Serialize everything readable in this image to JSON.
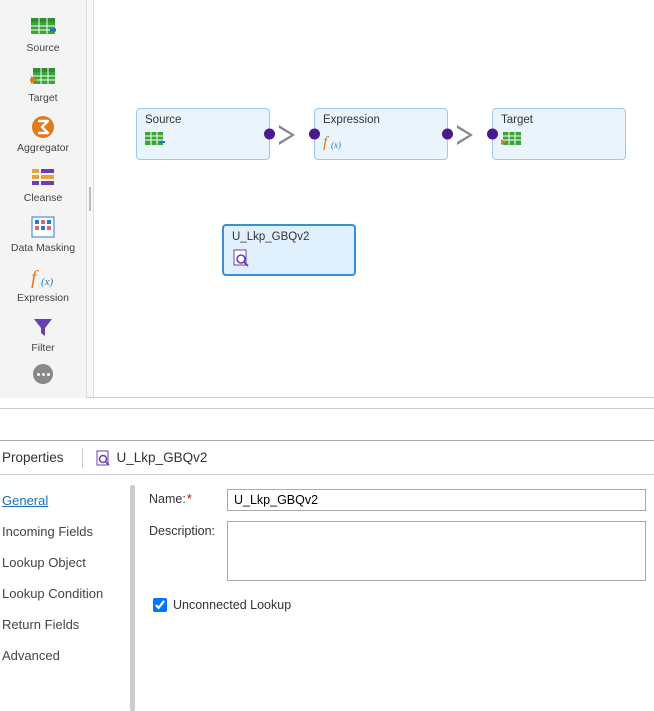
{
  "palette": {
    "items": [
      {
        "label": "Source",
        "icon": "source-icon"
      },
      {
        "label": "Target",
        "icon": "target-icon"
      },
      {
        "label": "Aggregator",
        "icon": "aggregator-icon"
      },
      {
        "label": "Cleanse",
        "icon": "cleanse-icon"
      },
      {
        "label": "Data Masking",
        "icon": "data-masking-icon"
      },
      {
        "label": "Expression",
        "icon": "expression-icon"
      },
      {
        "label": "Filter",
        "icon": "filter-icon"
      }
    ]
  },
  "canvas": {
    "nodes": {
      "source": {
        "label": "Source",
        "icon": "source-icon"
      },
      "expression": {
        "label": "Expression",
        "icon": "expression-icon"
      },
      "target": {
        "label": "Target",
        "icon": "target-icon"
      },
      "lookup": {
        "label": "U_Lkp_GBQv2",
        "icon": "lookup-icon",
        "selected": true
      }
    }
  },
  "properties": {
    "panel_title": "Properties",
    "object_name": "U_Lkp_GBQv2",
    "tabs": [
      "General",
      "Incoming Fields",
      "Lookup Object",
      "Lookup Condition",
      "Return Fields",
      "Advanced"
    ],
    "active_tab": "General",
    "form": {
      "name_label": "Name:",
      "name_value": "U_Lkp_GBQv2",
      "description_label": "Description:",
      "description_value": "",
      "unconnected_label": "Unconnected Lookup",
      "unconnected_checked": true
    }
  }
}
